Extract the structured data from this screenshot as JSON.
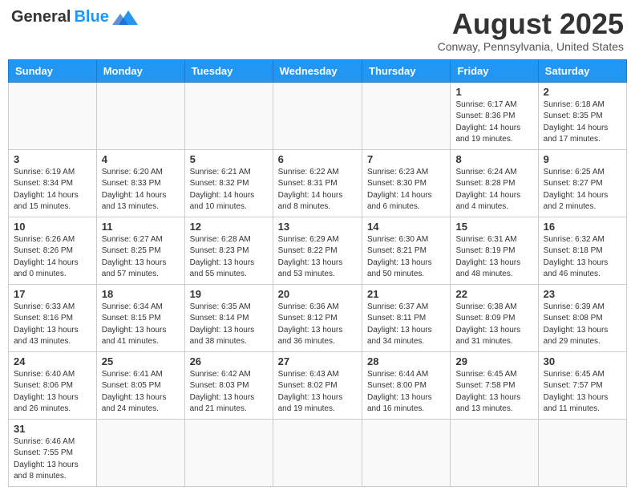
{
  "header": {
    "logo_general": "General",
    "logo_blue": "Blue",
    "month": "August 2025",
    "location": "Conway, Pennsylvania, United States"
  },
  "days": [
    "Sunday",
    "Monday",
    "Tuesday",
    "Wednesday",
    "Thursday",
    "Friday",
    "Saturday"
  ],
  "weeks": [
    [
      {
        "date": "",
        "info": ""
      },
      {
        "date": "",
        "info": ""
      },
      {
        "date": "",
        "info": ""
      },
      {
        "date": "",
        "info": ""
      },
      {
        "date": "",
        "info": ""
      },
      {
        "date": "1",
        "info": "Sunrise: 6:17 AM\nSunset: 8:36 PM\nDaylight: 14 hours and 19 minutes."
      },
      {
        "date": "2",
        "info": "Sunrise: 6:18 AM\nSunset: 8:35 PM\nDaylight: 14 hours and 17 minutes."
      }
    ],
    [
      {
        "date": "3",
        "info": "Sunrise: 6:19 AM\nSunset: 8:34 PM\nDaylight: 14 hours and 15 minutes."
      },
      {
        "date": "4",
        "info": "Sunrise: 6:20 AM\nSunset: 8:33 PM\nDaylight: 14 hours and 13 minutes."
      },
      {
        "date": "5",
        "info": "Sunrise: 6:21 AM\nSunset: 8:32 PM\nDaylight: 14 hours and 10 minutes."
      },
      {
        "date": "6",
        "info": "Sunrise: 6:22 AM\nSunset: 8:31 PM\nDaylight: 14 hours and 8 minutes."
      },
      {
        "date": "7",
        "info": "Sunrise: 6:23 AM\nSunset: 8:30 PM\nDaylight: 14 hours and 6 minutes."
      },
      {
        "date": "8",
        "info": "Sunrise: 6:24 AM\nSunset: 8:28 PM\nDaylight: 14 hours and 4 minutes."
      },
      {
        "date": "9",
        "info": "Sunrise: 6:25 AM\nSunset: 8:27 PM\nDaylight: 14 hours and 2 minutes."
      }
    ],
    [
      {
        "date": "10",
        "info": "Sunrise: 6:26 AM\nSunset: 8:26 PM\nDaylight: 14 hours and 0 minutes."
      },
      {
        "date": "11",
        "info": "Sunrise: 6:27 AM\nSunset: 8:25 PM\nDaylight: 13 hours and 57 minutes."
      },
      {
        "date": "12",
        "info": "Sunrise: 6:28 AM\nSunset: 8:23 PM\nDaylight: 13 hours and 55 minutes."
      },
      {
        "date": "13",
        "info": "Sunrise: 6:29 AM\nSunset: 8:22 PM\nDaylight: 13 hours and 53 minutes."
      },
      {
        "date": "14",
        "info": "Sunrise: 6:30 AM\nSunset: 8:21 PM\nDaylight: 13 hours and 50 minutes."
      },
      {
        "date": "15",
        "info": "Sunrise: 6:31 AM\nSunset: 8:19 PM\nDaylight: 13 hours and 48 minutes."
      },
      {
        "date": "16",
        "info": "Sunrise: 6:32 AM\nSunset: 8:18 PM\nDaylight: 13 hours and 46 minutes."
      }
    ],
    [
      {
        "date": "17",
        "info": "Sunrise: 6:33 AM\nSunset: 8:16 PM\nDaylight: 13 hours and 43 minutes."
      },
      {
        "date": "18",
        "info": "Sunrise: 6:34 AM\nSunset: 8:15 PM\nDaylight: 13 hours and 41 minutes."
      },
      {
        "date": "19",
        "info": "Sunrise: 6:35 AM\nSunset: 8:14 PM\nDaylight: 13 hours and 38 minutes."
      },
      {
        "date": "20",
        "info": "Sunrise: 6:36 AM\nSunset: 8:12 PM\nDaylight: 13 hours and 36 minutes."
      },
      {
        "date": "21",
        "info": "Sunrise: 6:37 AM\nSunset: 8:11 PM\nDaylight: 13 hours and 34 minutes."
      },
      {
        "date": "22",
        "info": "Sunrise: 6:38 AM\nSunset: 8:09 PM\nDaylight: 13 hours and 31 minutes."
      },
      {
        "date": "23",
        "info": "Sunrise: 6:39 AM\nSunset: 8:08 PM\nDaylight: 13 hours and 29 minutes."
      }
    ],
    [
      {
        "date": "24",
        "info": "Sunrise: 6:40 AM\nSunset: 8:06 PM\nDaylight: 13 hours and 26 minutes."
      },
      {
        "date": "25",
        "info": "Sunrise: 6:41 AM\nSunset: 8:05 PM\nDaylight: 13 hours and 24 minutes."
      },
      {
        "date": "26",
        "info": "Sunrise: 6:42 AM\nSunset: 8:03 PM\nDaylight: 13 hours and 21 minutes."
      },
      {
        "date": "27",
        "info": "Sunrise: 6:43 AM\nSunset: 8:02 PM\nDaylight: 13 hours and 19 minutes."
      },
      {
        "date": "28",
        "info": "Sunrise: 6:44 AM\nSunset: 8:00 PM\nDaylight: 13 hours and 16 minutes."
      },
      {
        "date": "29",
        "info": "Sunrise: 6:45 AM\nSunset: 7:58 PM\nDaylight: 13 hours and 13 minutes."
      },
      {
        "date": "30",
        "info": "Sunrise: 6:45 AM\nSunset: 7:57 PM\nDaylight: 13 hours and 11 minutes."
      }
    ],
    [
      {
        "date": "31",
        "info": "Sunrise: 6:46 AM\nSunset: 7:55 PM\nDaylight: 13 hours and 8 minutes."
      },
      {
        "date": "",
        "info": ""
      },
      {
        "date": "",
        "info": ""
      },
      {
        "date": "",
        "info": ""
      },
      {
        "date": "",
        "info": ""
      },
      {
        "date": "",
        "info": ""
      },
      {
        "date": "",
        "info": ""
      }
    ]
  ]
}
